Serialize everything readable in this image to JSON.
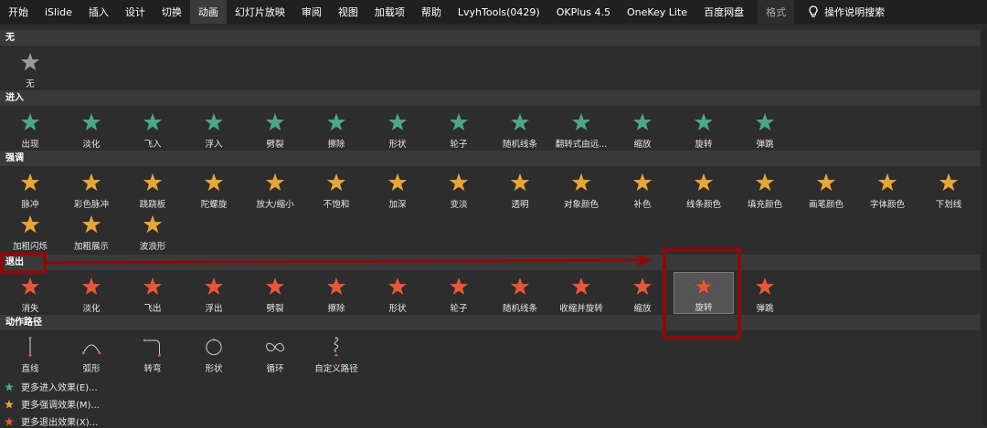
{
  "ribbon": {
    "tabs": [
      {
        "label": "开始",
        "active": false
      },
      {
        "label": "iSlide",
        "active": false
      },
      {
        "label": "插入",
        "active": false
      },
      {
        "label": "设计",
        "active": false
      },
      {
        "label": "切换",
        "active": false
      },
      {
        "label": "动画",
        "active": true
      },
      {
        "label": "幻灯片放映",
        "active": false
      },
      {
        "label": "审阅",
        "active": false
      },
      {
        "label": "视图",
        "active": false
      },
      {
        "label": "加载项",
        "active": false
      },
      {
        "label": "帮助",
        "active": false
      },
      {
        "label": "LvyhTools(0429)",
        "active": false
      },
      {
        "label": "OKPlus 4.5",
        "active": false
      },
      {
        "label": "OneKey Lite",
        "active": false
      },
      {
        "label": "百度网盘",
        "active": false
      }
    ],
    "format_tab": "格式",
    "search_label": "操作说明搜索"
  },
  "sections": {
    "none": {
      "title": "无",
      "items": [
        "无"
      ]
    },
    "entrance": {
      "title": "进入",
      "items": [
        "出现",
        "淡化",
        "飞入",
        "浮入",
        "劈裂",
        "擦除",
        "形状",
        "轮子",
        "随机线条",
        "翻转式由远...",
        "缩放",
        "旋转",
        "弹跳"
      ]
    },
    "emphasis": {
      "title": "强调",
      "items": [
        "脉冲",
        "彩色脉冲",
        "跷跷板",
        "陀螺旋",
        "放大/缩小",
        "不饱和",
        "加深",
        "变淡",
        "透明",
        "对象颜色",
        "补色",
        "线条颜色",
        "填充颜色",
        "画笔颜色",
        "字体颜色",
        "下划线",
        "加粗闪烁",
        "加粗展示",
        "波浪形"
      ]
    },
    "exit": {
      "title": "退出",
      "items": [
        "消失",
        "淡化",
        "飞出",
        "浮出",
        "劈裂",
        "擦除",
        "形状",
        "轮子",
        "随机线条",
        "收缩并旋转",
        "缩放",
        "旋转",
        "弹跳"
      ],
      "selected_index": 11
    },
    "motion": {
      "title": "动作路径",
      "items": [
        "直线",
        "弧形",
        "转弯",
        "形状",
        "循环",
        "自定义路径"
      ]
    }
  },
  "more_effects": [
    {
      "label": "更多进入效果(E)...",
      "star_color": "#4fa58a"
    },
    {
      "label": "更多强调效果(M)...",
      "star_color": "#e6a63c"
    },
    {
      "label": "更多退出效果(X)...",
      "star_color": "#e2583e"
    }
  ],
  "colors": {
    "entrance_star": "#4fa58a",
    "emphasis_star": "#e6a63c",
    "exit_star": "#e2583e",
    "none_star": "#9a9a9a",
    "annotation": "#8b0a0f"
  },
  "icons": {
    "star": "star-icon",
    "search": "lightbulb-icon",
    "path": "motion-path-icon"
  }
}
